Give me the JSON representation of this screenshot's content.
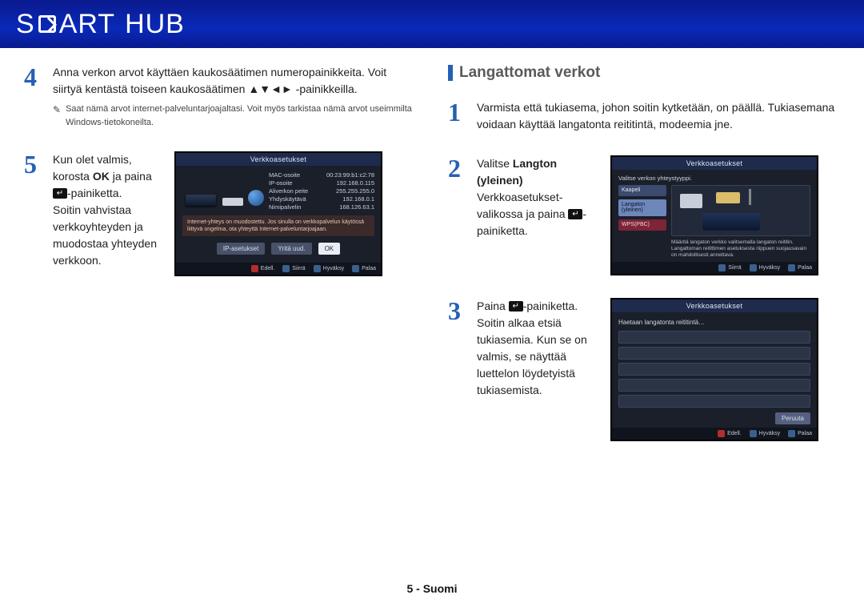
{
  "brand": {
    "s": "S",
    "art": "ART",
    "hub": "HUB"
  },
  "left": {
    "step4": {
      "num": "4",
      "text": "Anna verkon arvot käyttäen kaukosäätimen numeropainikkeita. Voit siirtyä kentästä toiseen kaukosäätimen ▲▼◄► -painikkeilla.",
      "note": "Saat nämä arvot internet-palveluntarjoajaltasi. Voit myös tarkistaa nämä arvot useimmilta Windows-tietokoneilta."
    },
    "step5": {
      "num": "5",
      "text1": "Kun olet valmis, korosta ",
      "bold1": "OK",
      "text2": " ja paina ",
      "text3": "-painiketta.\nSoitin vahvistaa verkkoyhteyden ja muodostaa yhteyden verkkoon."
    }
  },
  "right": {
    "heading": "Langattomat verkot",
    "step1": {
      "num": "1",
      "text": "Varmista että tukiasema, johon soitin kytketään, on päällä. Tukiasemana voidaan käyttää langatonta reititintä, modeemia jne."
    },
    "step2": {
      "num": "2",
      "lead": "Valitse ",
      "bold": "Langton (yleinen)",
      "tail": " Verkkoasetukset-valikossa ja paina ",
      "tail2": "-painiketta."
    },
    "step3": {
      "num": "3",
      "lead": "Paina ",
      "mid": "-painiketta. Soitin alkaa etsiä tukiasemia. Kun se on valmis, se näyttää luettelon löydetyistä tukiasemista."
    }
  },
  "thumb1": {
    "title": "Verkkoasetukset",
    "rows": {
      "mac_l": "MAC-osoite",
      "mac_v": "00:23:99:b1:c2:78",
      "ip_l": "IP-osoite",
      "ip_v": "192.168.0.115",
      "sub_l": "Aliverkon peite",
      "sub_v": "255.255.255.0",
      "gw_l": "Yhdyskäytävä",
      "gw_v": "192.168.0.1",
      "dns_l": "Nimipalvelin",
      "dns_v": "168.126.63.1"
    },
    "info": "Internet-yhteys on muodostettu. Jos sinulla on verkkopalvelun käytössä liittyvä ongelma, ota yhteyttä Internet-palveluntarjoajaan.",
    "btns": {
      "ip": "IP-asetukset",
      "retry": "Yritä uud.",
      "ok": "OK"
    },
    "footer": {
      "a": "Edell.",
      "mv": "Siirrä",
      "ok": "Hyväksy",
      "bk": "Palaa"
    }
  },
  "thumb2": {
    "title": "Verkkoasetukset",
    "sub": "Valitse verkon yhteystyyppi.",
    "side": {
      "cable": "Kaapeli",
      "wlan": "Langaton (yleinen)",
      "wps": "WPS(PBC)"
    },
    "note": "Määritä langaton verkko valitsemalla langaton reititin. Langattoman reitittimen asetuksesta riippuen suojausavain on mahdollisesti annettava.",
    "footer": {
      "mv": "Siirrä",
      "ok": "Hyväksy",
      "bk": "Palaa"
    }
  },
  "thumb3": {
    "title": "Verkkoasetukset",
    "sub": "Haetaan langatonta reititintä…",
    "cancel": "Peruuta",
    "footer": {
      "a": "Edell.",
      "ok": "Hyväksy",
      "bk": "Palaa"
    }
  },
  "footer": "5 - Suomi",
  "note_bullet": "✎"
}
